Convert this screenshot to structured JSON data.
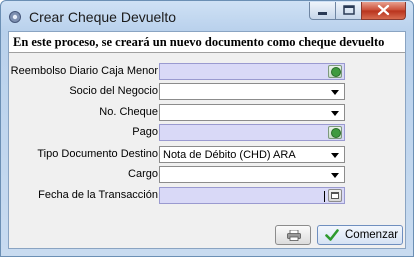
{
  "window": {
    "title": "Crear Cheque Devuelto"
  },
  "banner": "En este proceso, se creará un nuevo documento como cheque devuelto",
  "fields": [
    {
      "label": "Reembolso Diario Caja Menor",
      "value": ""
    },
    {
      "label": "Socio del Negocio",
      "value": ""
    },
    {
      "label": "No. Cheque",
      "value": ""
    },
    {
      "label": "Pago",
      "value": ""
    },
    {
      "label": "Tipo Documento Destino",
      "value": "Nota de Débito (CHD) ARA"
    },
    {
      "label": "Cargo",
      "value": ""
    },
    {
      "label": "Fecha de la Transacción",
      "value": ""
    }
  ],
  "buttons": {
    "print_icon": "printer-icon",
    "ok_label": "Comenzar",
    "ok_icon": "checkmark-icon"
  },
  "colors": {
    "lookup_field": "#d9d9f7",
    "title_gradient": "#b9d1ec"
  }
}
